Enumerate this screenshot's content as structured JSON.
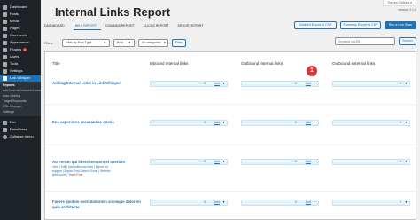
{
  "sidebar": {
    "items": [
      {
        "label": "Dashboard",
        "icon": "dashboard-icon"
      },
      {
        "label": "Posts",
        "icon": "posts-icon"
      },
      {
        "label": "Media",
        "icon": "media-icon"
      },
      {
        "label": "Pages",
        "icon": "pages-icon"
      },
      {
        "label": "Comments",
        "icon": "comments-icon"
      },
      {
        "label": "Appearance",
        "icon": "appearance-icon"
      },
      {
        "label": "Plugins",
        "icon": "plugins-icon",
        "badge": "2"
      },
      {
        "label": "Users",
        "icon": "users-icon"
      },
      {
        "label": "Tools",
        "icon": "tools-icon"
      },
      {
        "label": "Settings",
        "icon": "settings-icon"
      },
      {
        "label": "Link Whisper",
        "icon": "link-whisper-icon",
        "active": true
      }
    ],
    "submenu": [
      "Reports",
      "Add Internal Inbound Links",
      "Auto-Linking",
      "Target Keywords",
      "URL Changer",
      "Settings"
    ],
    "after": [
      {
        "label": "Divi",
        "icon": "divi-icon"
      },
      {
        "label": "FatorPress",
        "icon": "fatorpress-icon"
      },
      {
        "label": "Collapse menu",
        "icon": "collapse-icon"
      }
    ]
  },
  "header": {
    "title": "Internal Links Report",
    "version": "version 2.1.0",
    "screen_options": "Screen Options"
  },
  "buttons": {
    "detailed_export": "Detailed Export to CSV",
    "summary_export": "Summary Export to CSV",
    "run_scan": "Run a Link Scan"
  },
  "tabs": [
    "DASHBOARD",
    "LINKS REPORT",
    "DOMAINS REPORT",
    "CLICKS REPORT",
    "ERROR REPORT"
  ],
  "filters": {
    "label": "Filters",
    "link_type": "Filter by Post Type",
    "post": "Post",
    "categories": "All categories",
    "filter_button": "Filter",
    "search_placeholder": "Keyword or URL",
    "search_button": "Search"
  },
  "table": {
    "columns": [
      "Title",
      "Inbound internal links",
      "Outbound internal links",
      "Outbound external links"
    ],
    "rows": [
      {
        "title": "Adding Internal Links in Link Whisper",
        "inbound": "0",
        "outbound_internal": "0",
        "outbound_external": "0"
      },
      {
        "title": "Eos asperiores recusandae omnis",
        "inbound": "0",
        "outbound_internal": "0",
        "outbound_external": "0"
      },
      {
        "title": "Aut rerum qui libero tempore et aperiam",
        "actions": [
          "View | Edit | Add outbound links | Export for",
          "support | Export Post Data to Excel | Refresh",
          "links count |"
        ],
        "trash": "Trash Post",
        "inbound": "0",
        "outbound_internal": "0",
        "outbound_external": "0"
      },
      {
        "title": "Facere quidem exercitationem similique dolorem quia architecto",
        "inbound": "0",
        "outbound_internal": "0",
        "outbound_external": "0"
      }
    ],
    "add_label": "Add",
    "badge_number": "1"
  }
}
